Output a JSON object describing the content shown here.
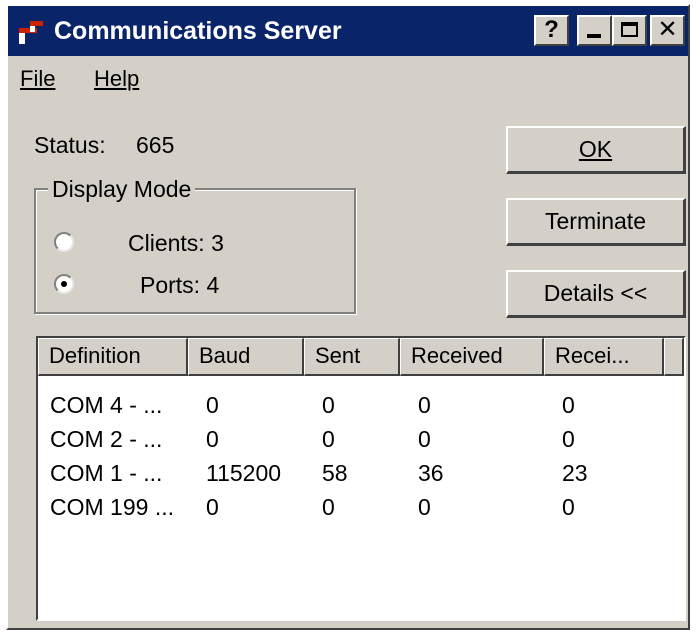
{
  "window": {
    "title": "Communications Server",
    "help_button": "?",
    "close_glyph": "✕",
    "title_bar_color": "#0a246a",
    "face_color": "#d4d0c8"
  },
  "menu": {
    "file": "File",
    "help": "Help"
  },
  "status": {
    "label": "Status:",
    "value": "665"
  },
  "display_mode": {
    "legend": "Display Mode",
    "clients_label": "Clients: 3",
    "ports_label": "Ports: 4",
    "selected": "ports"
  },
  "buttons": {
    "ok": "OK",
    "terminate": "Terminate",
    "details": "Details <<"
  },
  "table": {
    "columns": [
      "Definition",
      "Baud",
      "Sent",
      "Received",
      "Recei..."
    ],
    "rows": [
      [
        "COM 4 - ...",
        "0",
        "0",
        "0",
        "0"
      ],
      [
        "COM 2 - ...",
        "0",
        "0",
        "0",
        "0"
      ],
      [
        "COM 1 - ...",
        "115200",
        "58",
        "36",
        "23"
      ],
      [
        "COM 199 ...",
        "0",
        "0",
        "0",
        "0"
      ]
    ]
  },
  "icons": {
    "app": "app-icon",
    "help": "help-icon",
    "minimize": "minimize-icon",
    "maximize": "maximize-icon",
    "close": "close-icon"
  }
}
